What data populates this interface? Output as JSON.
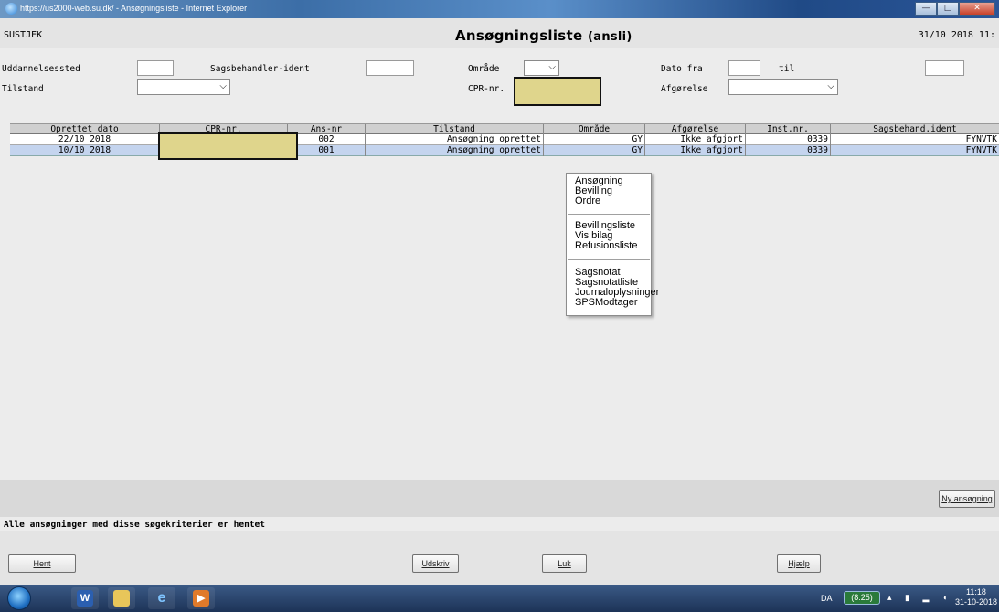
{
  "window": {
    "title": "https://us2000-web.su.dk/ - Ansøgningsliste - Internet Explorer",
    "min_glyph": "—",
    "max_glyph": "□",
    "close_glyph": "✕"
  },
  "header": {
    "system": "SUSTJEK",
    "page_title": "Ansøgningsliste",
    "page_code": "(ansli)",
    "datetime": "31/10 2018 11:"
  },
  "search": {
    "uddannelsessted_label": "Uddannelsessted",
    "uddannelsessted_value": "",
    "sagsbehandler_label": "Sagsbehandler-ident",
    "sagsbehandler_value": "",
    "omraade_label": "Område",
    "omraade_value": "",
    "dato_fra_label": "Dato fra",
    "dato_fra_value": "",
    "til_label": "til",
    "til_value": "",
    "tilstand_label": "Tilstand",
    "tilstand_value": "",
    "cpr_label": "CPR-nr.",
    "afgoerelse_label": "Afgørelse",
    "afgoerelse_value": ""
  },
  "table": {
    "headers": [
      "Oprettet dato",
      "CPR-nr.",
      "Ans-nr",
      "Tilstand",
      "Område",
      "Afgørelse",
      "Inst.nr.",
      "Sagsbehand.ident"
    ],
    "rows": [
      {
        "dato": "22/10 2018",
        "cpr": "",
        "ans": "002",
        "tilstand": "Ansøgning oprettet",
        "omraade": "GY",
        "afgoerelse": "Ikke afgjort",
        "inst": "0339",
        "ident": "FYNVTK"
      },
      {
        "dato": "10/10 2018",
        "cpr": "",
        "ans": "001",
        "tilstand": "Ansøgning oprettet",
        "omraade": "GY",
        "afgoerelse": "Ikke afgjort",
        "inst": "0339",
        "ident": "FYNVTK"
      }
    ]
  },
  "context_menu": {
    "items": [
      "Ansøgning",
      "Bevilling",
      "Ordre",
      "Bevillingsliste",
      "Vis bilag",
      "Refusionsliste",
      "Sagsnotat",
      "Sagsnotatliste",
      "Journaloplysninger",
      "SPSModtager"
    ]
  },
  "actions": {
    "ny_ansoegning": "Ny ansøgning",
    "hent": "Hent",
    "udskriv": "Udskriv",
    "luk": "Luk",
    "hjaelp": "Hjælp"
  },
  "status_message": "Alle ansøgninger med disse søgekriterier er hentet",
  "taskbar": {
    "word_glyph": "W",
    "media_glyph": "▶",
    "language": "DA",
    "battery": "(8:25)",
    "time": "11:18",
    "date": "31-10-2018"
  },
  "colors": {
    "redaction": "#dfd58c",
    "selected_row": "#c4d4ee"
  }
}
